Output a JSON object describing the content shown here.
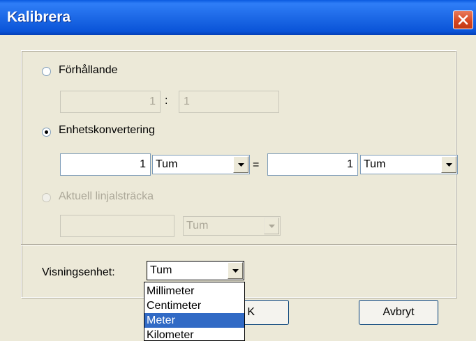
{
  "window": {
    "title": "Kalibrera"
  },
  "ratio": {
    "label": "Förhållande",
    "left_value": "1",
    "separator": ":",
    "right_value": "1",
    "selected": false,
    "enabled": true
  },
  "unit_conversion": {
    "label": "Enhetskonvertering",
    "selected": true,
    "left_value": "1",
    "left_unit": "Tum",
    "equals": "=",
    "right_value": "1",
    "right_unit": "Tum"
  },
  "actual_ruler": {
    "label": "Aktuell linjalsträcka",
    "selected": false,
    "enabled": false,
    "value": "",
    "unit": "Tum"
  },
  "display_unit": {
    "label": "Visningsenhet:",
    "value": "Tum",
    "options": [
      "Millimeter",
      "Centimeter",
      "Meter",
      "Kilometer"
    ],
    "highlighted": "Meter"
  },
  "buttons": {
    "ok_label": "OK",
    "ok_visible_fragment": "K",
    "cancel_label": "Avbryt"
  },
  "icons": {
    "close": "close-icon",
    "dropdown": "chevron-down-icon"
  },
  "colors": {
    "titlebar": "#0a54d8",
    "close_button": "#d5451f",
    "dialog_bg": "#ece9d8",
    "selection": "#316ac5"
  }
}
